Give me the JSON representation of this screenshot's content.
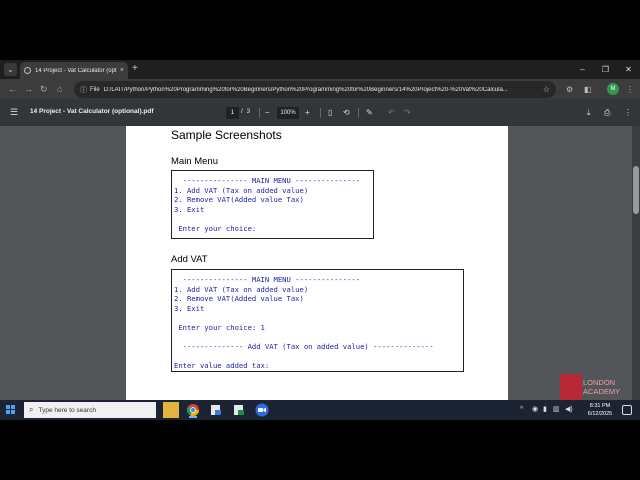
{
  "browser": {
    "tab_title": "14 Project - Vat Calculator (opti",
    "tab_close": "×",
    "new_tab": "+",
    "url_chip": "File",
    "url": "D:/LAIT/Python/Python%20Programming%20for%20Beginners/Python%20Programming%20for%20Beginners/14%20Project%20-%20Vat%20Calcula...",
    "profile_initial": "M",
    "window_controls": {
      "minimize": "–",
      "maximize": "❐",
      "close": "✕"
    }
  },
  "pdf_toolbar": {
    "title": "14 Project - Vat Calculator (optional).pdf",
    "current_page": "1",
    "page_separator": "/",
    "total_pages": "3",
    "zoom": "100%"
  },
  "document": {
    "heading": "Sample Screenshots",
    "section1_title": "Main Menu",
    "section1_lines": [
      "  --------------- MAIN MENU ---------------",
      "1. Add VAT (Tax on added value)",
      "2. Remove VAT(Added value Tax)",
      "3. Exit",
      "",
      " Enter your choice:"
    ],
    "section2_title": "Add VAT",
    "section2_lines": [
      "  --------------- MAIN MENU ---------------",
      "1. Add VAT (Tax on added value)",
      "2. Remove VAT(Added value Tax)",
      "3. Exit",
      "",
      " Enter your choice: 1",
      "",
      "  -------------- Add VAT (Tax on added value) --------------",
      "",
      "Enter value added tax:"
    ]
  },
  "watermark": {
    "text": "LONDON\nACADEMY"
  },
  "taskbar": {
    "search_placeholder": "Type here to search",
    "time": "8:31 PM",
    "date": "6/12/2025"
  },
  "colors": {
    "console_text": "#2222aa",
    "viewer_bg": "#525659",
    "pdf_toolbar_bg": "#323639",
    "logo_red": "#c8202f"
  }
}
